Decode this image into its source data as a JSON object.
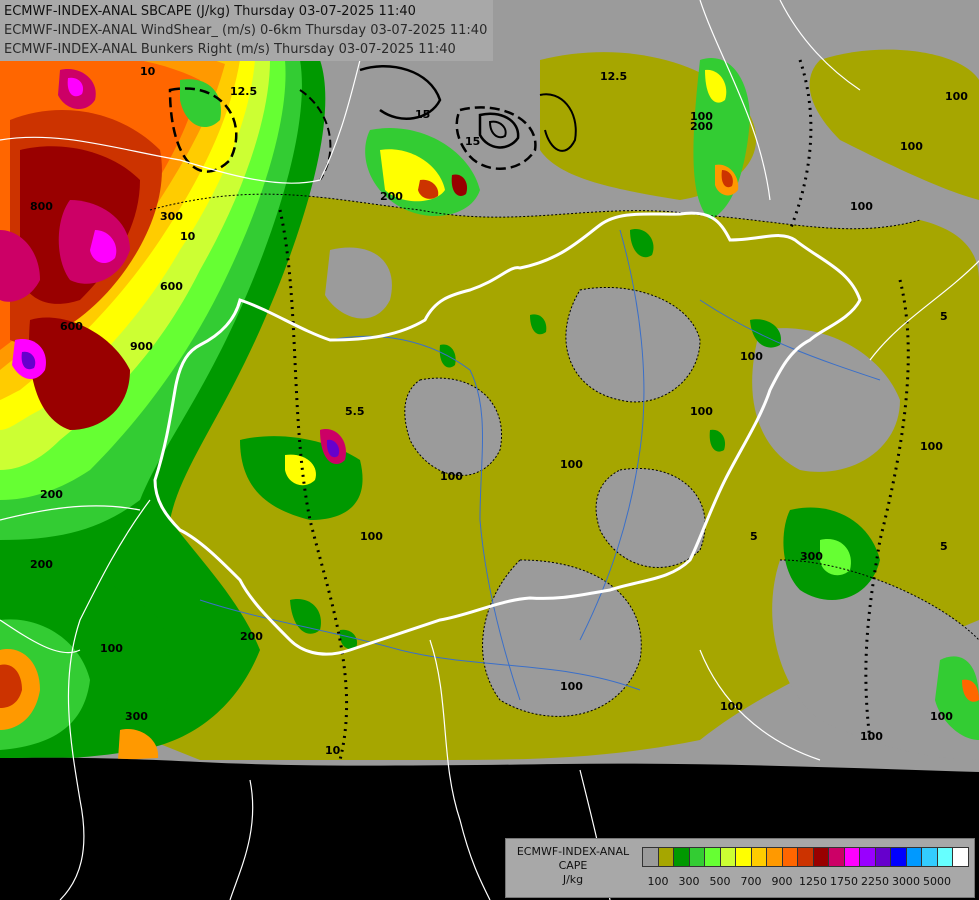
{
  "header": {
    "line1": "ECMWF-INDEX-ANAL SBCAPE (J/kg) Thursday 03-07-2025 11:40",
    "line2": "ECMWF-INDEX-ANAL WindShear_ (m/s) 0-6km Thursday 03-07-2025 11:40",
    "line3": "ECMWF-INDEX-ANAL Bunkers Right (m/s) Thursday 03-07-2025 11:40"
  },
  "legend": {
    "title1": "ECMWF-INDEX-ANAL",
    "title2": "CAPE",
    "title3": "J/kg",
    "colors": [
      "#9b9b9b",
      "#a6a600",
      "#009900",
      "#33cc33",
      "#66ff33",
      "#ccff33",
      "#ffff00",
      "#ffcc00",
      "#ff9900",
      "#ff6600",
      "#cc3300",
      "#990000",
      "#cc0066",
      "#ff00ff",
      "#9900ff",
      "#6600cc",
      "#0000ff",
      "#0099ff",
      "#33ccff",
      "#66ffff",
      "#ffffff"
    ],
    "ticks": [
      "100",
      "300",
      "500",
      "700",
      "900",
      "1250",
      "1750",
      "2250",
      "3000",
      "5000"
    ]
  },
  "contour_labels": [
    "100",
    "200",
    "300",
    "500",
    "600",
    "800",
    "900",
    "10",
    "12.5",
    "15",
    "5",
    "5.5"
  ],
  "colors": {
    "border_country": "#ffffff",
    "water": "#3a6fc9",
    "outside": "#000000"
  }
}
